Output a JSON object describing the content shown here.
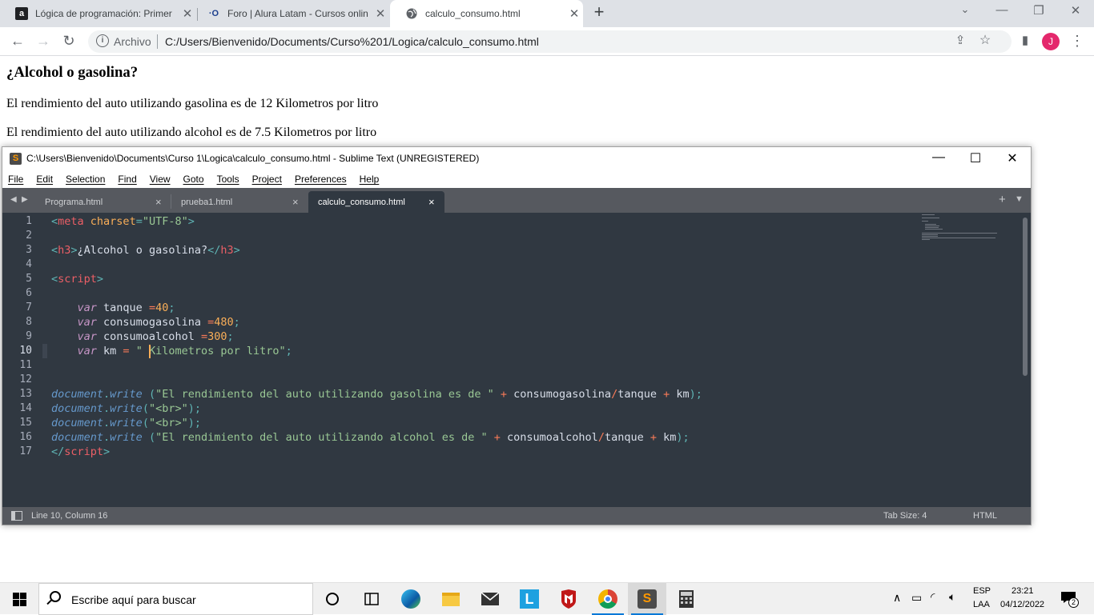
{
  "browser": {
    "tabs": [
      {
        "title": "Lógica de programación: Primer",
        "icon": "alura-icon",
        "active": false
      },
      {
        "title": "Foro | Alura Latam - Cursos onlin",
        "icon": "alura-forum-icon",
        "active": false
      },
      {
        "title": "calculo_consumo.html",
        "icon": "globe-icon",
        "active": true
      }
    ],
    "address_scheme": "Archivo",
    "address_url": "C:/Users/Bienvenido/Documents/Curso%201/Logica/calculo_consumo.html",
    "profile_initial": "J",
    "profile_color": "#e4286c"
  },
  "page": {
    "heading": "¿Alcohol o gasolina?",
    "lines": [
      "El rendimiento del auto utilizando gasolina es de 12 Kilometros por litro",
      "El rendimiento del auto utilizando alcohol es de 7.5 Kilometros por litro"
    ]
  },
  "editor": {
    "window_title": "C:\\Users\\Bienvenido\\Documents\\Curso 1\\Logica\\calculo_consumo.html - Sublime Text (UNREGISTERED)",
    "menu": [
      "File",
      "Edit",
      "Selection",
      "Find",
      "View",
      "Goto",
      "Tools",
      "Project",
      "Preferences",
      "Help"
    ],
    "tabs": [
      {
        "label": "Programa.html",
        "active": false
      },
      {
        "label": "prueba1.html",
        "active": false
      },
      {
        "label": "calculo_consumo.html",
        "active": true
      }
    ],
    "line_numbers": [
      "1",
      "2",
      "3",
      "4",
      "5",
      "6",
      "7",
      "8",
      "9",
      "10",
      "11",
      "12",
      "13",
      "14",
      "15",
      "16",
      "17"
    ],
    "current_line": 10,
    "status_position": "Line 10, Column 16",
    "status_tab_size": "Tab Size: 4",
    "status_syntax": "HTML",
    "background_color": "#303841"
  },
  "taskbar": {
    "search_placeholder": "Escribe aquí para buscar",
    "lang_top": "ESP",
    "lang_bottom": "LAA",
    "time": "23:21",
    "date": "04/12/2022",
    "notification_count": "2"
  }
}
